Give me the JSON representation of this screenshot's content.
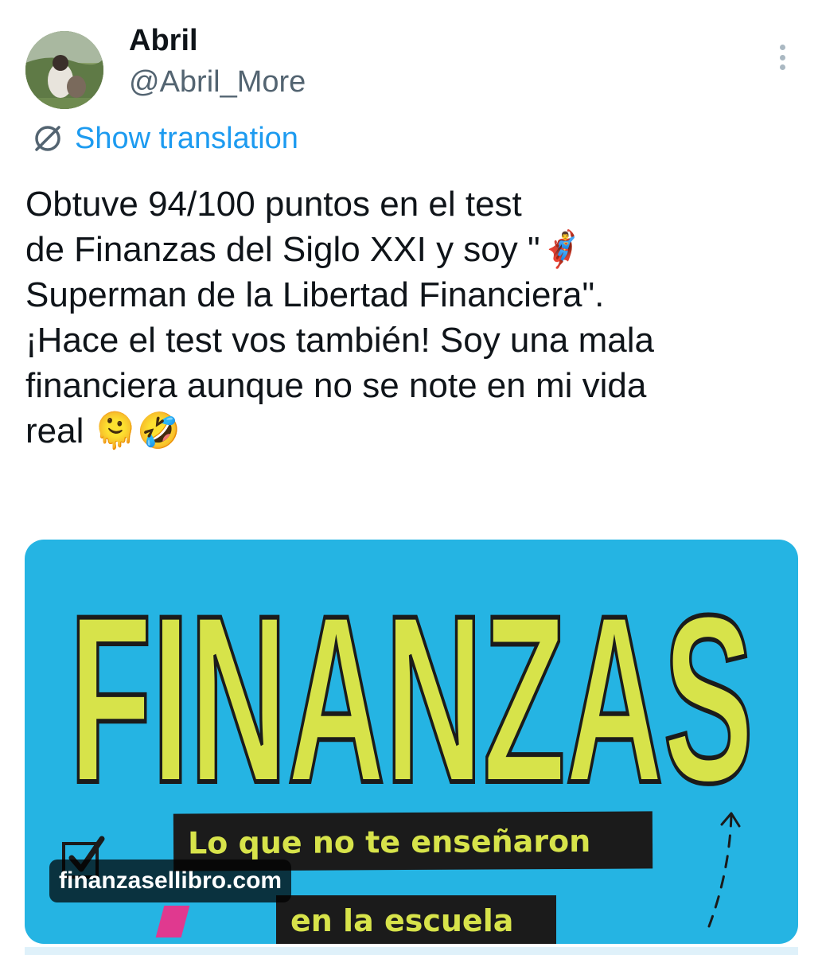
{
  "author": {
    "display_name": "Abril",
    "handle": "@Abril_More"
  },
  "translate": {
    "label": "Show translation",
    "icon": "globe-off-icon"
  },
  "tweet": {
    "lines": [
      "Obtuve 94/100 puntos en el test",
      "de Finanzas del Siglo XXI y soy \"🦸‍♂️",
      "Superman de la Libertad Financiera\".",
      "¡Hace el test vos también! Soy una mala",
      "financiera aunque no se note en mi vida",
      "real 🫠🤣"
    ]
  },
  "media": {
    "title": "FINANZAS",
    "banner_line1": "Lo que no te enseñaron",
    "banner_line2": "en la escuela",
    "link_label": "finanzasellibro.com"
  },
  "colors": {
    "link": "#1d9bf0",
    "media_background": "#25b4e3",
    "title_yellow": "#d7e34a",
    "banner_dark": "#1b1b1b"
  }
}
